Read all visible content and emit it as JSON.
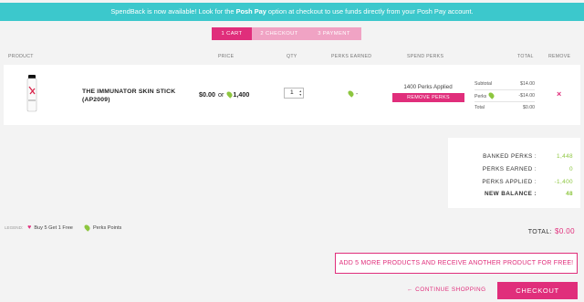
{
  "banner": {
    "before": "SpendBack is now available! Look for the ",
    "highlight": "Posh Pay",
    "after": " option at checkout to use funds directly from your Posh Pay account."
  },
  "steps": [
    "1 CART",
    "2 CHECKOUT",
    "3 PAYMENT"
  ],
  "headers": {
    "product": "PRODUCT",
    "price": "PRICE",
    "qty": "QTY",
    "perks_earned": "PERKS EARNED",
    "spend_perks": "SPEND PERKS",
    "total": "TOTAL",
    "remove": "REMOVE"
  },
  "item": {
    "name": "THE IMMUNATOR SKIN STICK",
    "sku": "(AP2009)",
    "price": "$0.00",
    "or": "or",
    "perks_price": "1,400",
    "qty": "1",
    "perks_earned": "-",
    "perks_applied": "1400 Perks Applied",
    "remove_perks_label": "REMOVE PERKS",
    "subtotal_label": "Subtotal",
    "subtotal": "$14.00",
    "perks_label": "Perks",
    "perks_value": "-$14.00",
    "total_label": "Total",
    "total": "$0.00",
    "remove_icon": "×"
  },
  "summary": {
    "banked_label": "BANKED PERKS :",
    "banked": "1,448",
    "earned_label": "PERKS EARNED :",
    "earned": "0",
    "applied_label": "PERKS APPLIED :",
    "applied": "-1,400",
    "balance_label": "NEW BALANCE :",
    "balance": "48"
  },
  "legend": {
    "label": "LEGEND:",
    "buy5": "Buy 5 Get 1 Free",
    "perks": "Perks Points"
  },
  "grand_total": {
    "label": "TOTAL:",
    "amount": "$0.00"
  },
  "promo": "ADD 5 MORE PRODUCTS AND RECEIVE ANOTHER PRODUCT FOR FREE!",
  "continue_shopping": "CONTINUE SHOPPING",
  "checkout": "CHECKOUT",
  "colors": {
    "accent": "#e02e7b",
    "banner": "#3cc8cc",
    "perks_green": "#8dc63f"
  },
  "icons": [
    "heart-icon",
    "leaf-icon",
    "close-icon",
    "arrow-left-icon"
  ]
}
